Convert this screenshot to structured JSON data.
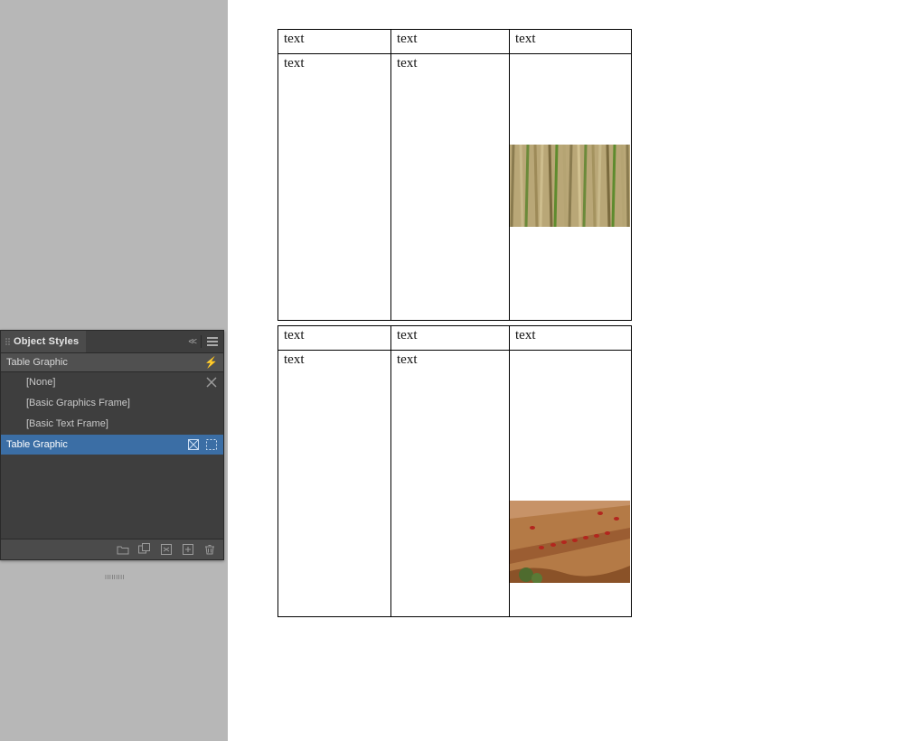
{
  "panel": {
    "title": "Object Styles",
    "current_style": "Table Graphic",
    "styles": [
      {
        "label": "[None]"
      },
      {
        "label": "[Basic Graphics Frame]"
      },
      {
        "label": "[Basic Text Frame]"
      },
      {
        "label": "Table Graphic",
        "selected": true
      }
    ],
    "dim_label": "IIIIIIIII"
  },
  "icons": {
    "collapse": "<<",
    "lightning": "⚡"
  },
  "tables": [
    {
      "id": "table1",
      "header": [
        "text",
        "text",
        "text"
      ],
      "body": [
        "text",
        "text",
        ""
      ],
      "image": {
        "cell": 2,
        "kind": "reeds"
      }
    },
    {
      "id": "table2",
      "header": [
        "text",
        "text",
        "text"
      ],
      "body": [
        "text",
        "text",
        ""
      ],
      "image": {
        "cell": 2,
        "kind": "cliff"
      }
    }
  ]
}
